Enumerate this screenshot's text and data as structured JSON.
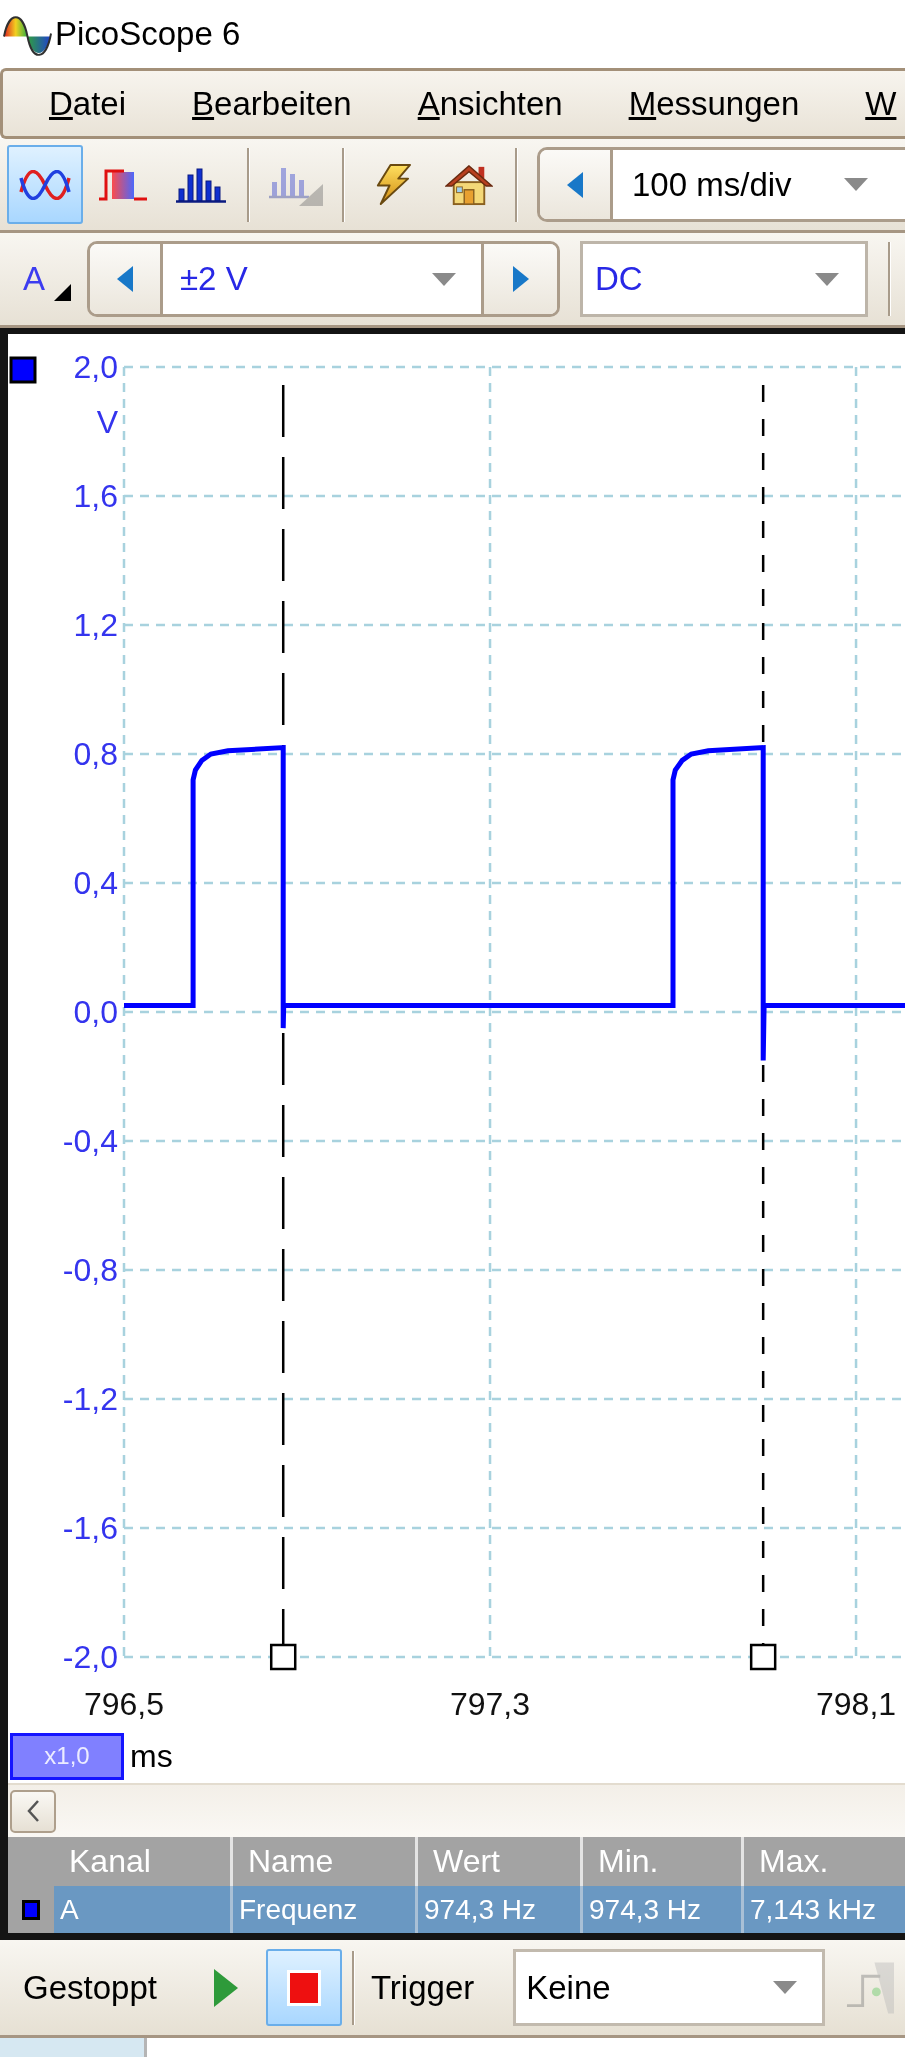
{
  "window": {
    "title": "PicoScope 6"
  },
  "menu": [
    "Datei",
    "Bearbeiten",
    "Ansichten",
    "Messungen",
    "W"
  ],
  "toolbar": {
    "mode_buttons": [
      {
        "selected": true
      },
      {
        "selected": false
      },
      {
        "selected": false
      }
    ],
    "tool_buttons": [
      {
        "disabled": true
      },
      {
        "disabled": false
      },
      {
        "disabled": false
      }
    ],
    "timebase": {
      "value": "100 ms/div"
    }
  },
  "channel_toolbar": {
    "channel": "A",
    "range": {
      "value": "±2 V"
    },
    "coupling": {
      "value": "DC"
    }
  },
  "plot": {
    "chart_data": {
      "type": "line",
      "xlabel": "ms",
      "ylabel": "V",
      "grid": true,
      "x": [
        796.5,
        796.651,
        796.651,
        796.656,
        796.67,
        796.69,
        796.727,
        796.848,
        796.848,
        796.849,
        797.7,
        797.7,
        797.705,
        797.72,
        797.74,
        797.777,
        797.897,
        797.897,
        797.899,
        798.207
      ],
      "series": [
        {
          "color": "#0000ff",
          "values": [
            0.02,
            0.02,
            0.72,
            0.75,
            0.78,
            0.8,
            0.81,
            0.82,
            -0.05,
            0.02,
            0.02,
            0.72,
            0.75,
            0.78,
            0.8,
            0.81,
            0.82,
            -0.15,
            0.02,
            0.02
          ]
        }
      ],
      "xlim": [
        796.5,
        798.207
      ],
      "ylim": [
        -2,
        2
      ],
      "xticks": [
        {
          "value": 796.5,
          "label": "796,5"
        },
        {
          "value": 797.3,
          "label": "797,3"
        },
        {
          "value": 798.1,
          "label": "798,1"
        }
      ],
      "yticks": [
        {
          "value": 2,
          "label": "2,0"
        },
        {
          "value": 1.6,
          "label": "1,6"
        },
        {
          "value": 1.2,
          "label": "1,2"
        },
        {
          "value": 0.8,
          "label": "0,8"
        },
        {
          "value": 0.4,
          "label": "0,4"
        },
        {
          "value": 0,
          "label": "0,0"
        },
        {
          "value": -0.4,
          "label": "-0,4"
        },
        {
          "value": -0.8,
          "label": "-0,8"
        },
        {
          "value": -1.2,
          "label": "-1,2"
        },
        {
          "value": -1.6,
          "label": "-1,6"
        },
        {
          "value": -2,
          "label": "-2,0"
        }
      ],
      "ref_lines": [
        {
          "axis": "x",
          "value": 796.848
        },
        {
          "axis": "x",
          "value": 797.897
        }
      ]
    },
    "zoom_factor": "x1,0"
  },
  "measurements": {
    "columns": [
      "Kanal",
      "Name",
      "Wert",
      "Min.",
      "Max."
    ],
    "rows": [
      {
        "selected": true,
        "color": "#0000ff",
        "cells": [
          "A",
          "Frequenz",
          "974,3 Hz",
          "974,3 Hz",
          "7,143 kHz"
        ]
      }
    ]
  },
  "status_bar": {
    "state": "Gestoppt",
    "run_buttons": [
      {
        "selected": false
      },
      {
        "selected": true
      }
    ],
    "trigger_label": "Trigger",
    "trigger_mode": {
      "value": "Keine"
    },
    "trigger_settings": {
      "disabled": true
    }
  }
}
